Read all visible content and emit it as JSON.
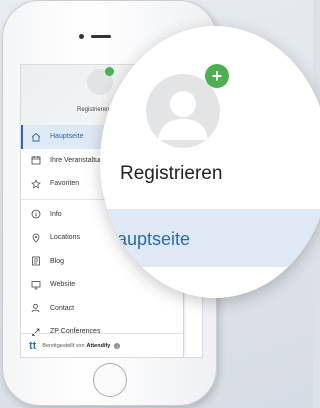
{
  "drawer": {
    "register_label": "Registrieren",
    "menu_items": [
      {
        "label": "Hauptseite",
        "icon": "home-icon",
        "active": true
      },
      {
        "label": "Ihre Veranstaltungen",
        "icon": "calendar-icon"
      },
      {
        "label": "Favoriten",
        "icon": "star-icon"
      },
      {
        "label": "Info",
        "icon": "info-icon"
      },
      {
        "label": "Locations",
        "icon": "location-pin-icon"
      },
      {
        "label": "Blog",
        "icon": "blog-icon"
      },
      {
        "label": "Website",
        "icon": "monitor-icon"
      },
      {
        "label": "Contact",
        "icon": "contact-icon"
      },
      {
        "label": "ZP Conferences",
        "icon": "link-icon"
      }
    ],
    "footer": {
      "logo": "tt",
      "text": "Bereitgestellt von",
      "brand": "Attendify"
    }
  },
  "zoom": {
    "register_label": "Registrieren",
    "active_item_label": "Hauptseite"
  },
  "colors": {
    "accent": "#2c6aa8",
    "active_bg": "#dfe9f5",
    "plus_green": "#4caf50"
  }
}
